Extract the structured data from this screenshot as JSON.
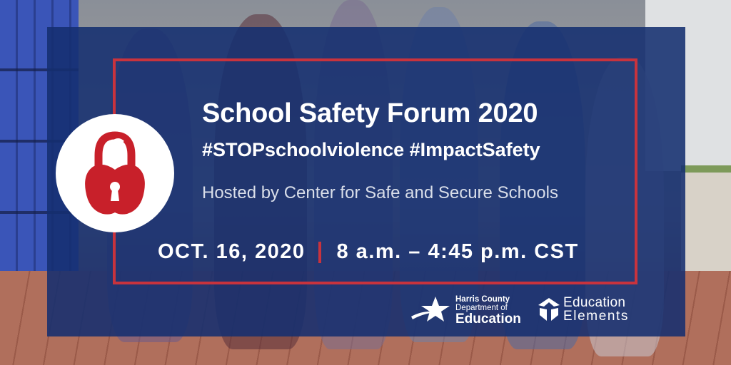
{
  "event": {
    "title": "School Safety Forum 2020",
    "hashtags": "#STOPschoolviolence #ImpactSafety",
    "host": "Hosted by Center for Safe and Secure Schools",
    "date": "OCT. 16, 2020",
    "time": "8 a.m. – 4:45 p.m. CST"
  },
  "logos": {
    "hcde": {
      "line1": "Harris County",
      "line2": "Department of",
      "line3": "Education"
    },
    "ee": {
      "line1": "Education",
      "line2": "Elements"
    }
  },
  "icons": {
    "badge": "apple-padlock-icon",
    "hcde": "star-swoosh-icon",
    "ee": "education-elements-mark-icon"
  },
  "colors": {
    "panel": "#142f70",
    "accent_red": "#c8333d",
    "text": "#ffffff"
  }
}
